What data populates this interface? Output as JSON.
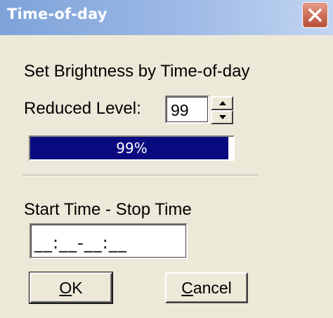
{
  "window": {
    "title": "Time-of-day",
    "close_icon": "close-x-icon",
    "colors": {
      "titlebar": "#9db9e6",
      "close_button": "#cc6b55",
      "progress_fill": "#0a0a80",
      "dialog_background": "#ece9d8"
    }
  },
  "brightness": {
    "heading": "Set Brightness by Time-of-day",
    "reduced_level_label": "Reduced Level:",
    "reduced_level_value": "99",
    "spin_up_icon": "arrow-up-icon",
    "spin_down_icon": "arrow-down-icon",
    "progress_percent": 99,
    "progress_text": "99%"
  },
  "time": {
    "label": "Start Time - Stop Time",
    "value": "__:__-__:__"
  },
  "buttons": {
    "ok_accel": "O",
    "ok_rest": "K",
    "cancel_accel": "C",
    "cancel_rest": "ancel"
  }
}
